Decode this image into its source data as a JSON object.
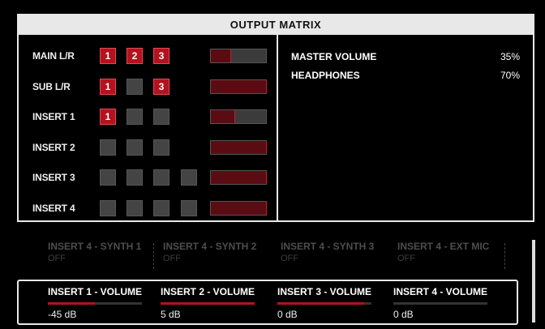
{
  "matrix": {
    "title": "OUTPUT MATRIX",
    "rows": [
      {
        "label": "MAIN L/R",
        "cells": [
          "1",
          "2",
          "3"
        ],
        "states": [
          true,
          true,
          true
        ],
        "level": 0.35
      },
      {
        "label": "SUB L/R",
        "cells": [
          "1",
          "",
          "3"
        ],
        "states": [
          true,
          false,
          true
        ],
        "level": 1.0
      },
      {
        "label": "INSERT 1",
        "cells": [
          "1",
          "",
          ""
        ],
        "states": [
          true,
          false,
          false
        ],
        "level": 0.42
      },
      {
        "label": "INSERT 2",
        "cells": [
          "",
          "",
          ""
        ],
        "states": [
          false,
          false,
          false
        ],
        "level": 1.0
      },
      {
        "label": "INSERT 3",
        "cells": [
          "",
          "",
          "",
          ""
        ],
        "states": [
          false,
          false,
          false,
          false
        ],
        "level": 1.0
      },
      {
        "label": "INSERT 4",
        "cells": [
          "",
          "",
          "",
          ""
        ],
        "states": [
          false,
          false,
          false,
          false
        ],
        "level": 1.0
      }
    ]
  },
  "levels": {
    "master_label": "MASTER VOLUME",
    "master_value": "35%",
    "headphones_label": "HEADPHONES",
    "headphones_value": "70%"
  },
  "source_tabs": [
    {
      "title": "INSERT 4 - SYNTH 1",
      "state": "OFF"
    },
    {
      "title": "INSERT 4 - SYNTH 2",
      "state": "OFF"
    },
    {
      "title": "INSERT 4 - SYNTH 3",
      "state": "OFF"
    },
    {
      "title": "INSERT 4 - EXT MIC",
      "state": "OFF"
    }
  ],
  "volume_tabs": [
    {
      "label": "INSERT 1 - VOLUME",
      "value": "-45 dB",
      "level": 0.5
    },
    {
      "label": "INSERT 2 - VOLUME",
      "value": "5 dB",
      "level": 1.0
    },
    {
      "label": "INSERT 3 - VOLUME",
      "value": "0 dB",
      "level": 0.92
    },
    {
      "label": "INSERT 4 - VOLUME",
      "value": "0 dB",
      "level": 0.0
    }
  ],
  "colors": {
    "accent": "#b3121e",
    "panel_border": "#e8e8e8"
  }
}
